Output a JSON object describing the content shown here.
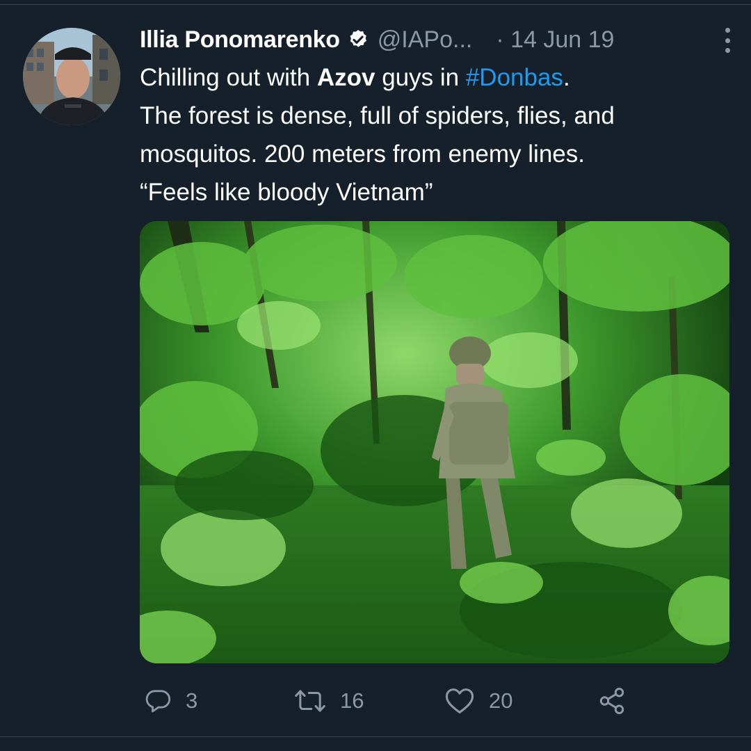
{
  "tweet": {
    "author_name": "Illia Ponomarenko",
    "handle": "@IAPo...",
    "date": "· 14 Jun 19",
    "text_lines": [
      [
        "Chilling out with ",
        "Azov",
        " guys in ",
        "#Donbas",
        "."
      ],
      [
        "The forest is dense, full of spiders, flies, and"
      ],
      [
        "mosquitos. 200 meters from enemy lines."
      ],
      [
        "“Feels like bloody Vietnam”"
      ]
    ]
  },
  "actions": {
    "reply_count": "3",
    "retweet_count": "16",
    "like_count": "20"
  },
  "icons": {
    "verified": "verified-badge-icon",
    "more": "more-options-icon",
    "reply": "reply-icon",
    "retweet": "retweet-icon",
    "like": "heart-icon",
    "share": "share-icon"
  },
  "colors": {
    "background": "#15202b",
    "text": "#ffffff",
    "secondary_text": "#8b98a5",
    "hashtag": "#1d9bf0"
  }
}
